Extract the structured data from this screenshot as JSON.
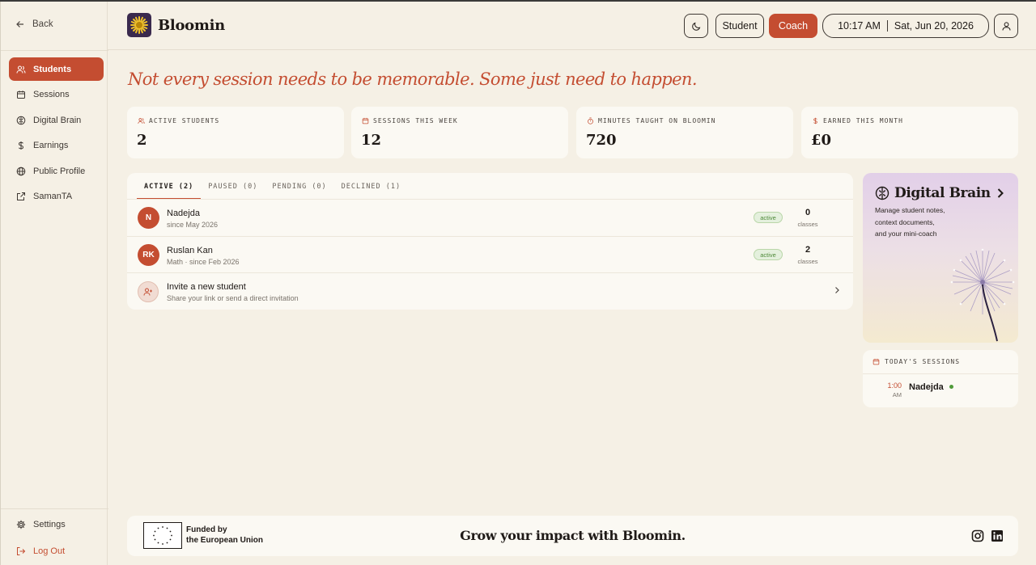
{
  "sidebar": {
    "back_label": "Back",
    "items": [
      {
        "label": "Students",
        "icon": "users-icon",
        "active": true
      },
      {
        "label": "Sessions",
        "icon": "calendar-icon"
      },
      {
        "label": "Digital Brain",
        "icon": "brain-icon"
      },
      {
        "label": "Earnings",
        "icon": "dollar-icon"
      },
      {
        "label": "Public Profile",
        "icon": "globe-icon"
      },
      {
        "label": "SamanTA",
        "icon": "external-link-icon"
      }
    ],
    "settings_label": "Settings",
    "logout_label": "Log Out"
  },
  "header": {
    "brand": "Bloomin",
    "student_label": "Student",
    "coach_label": "Coach",
    "time": "10:17 AM",
    "date": "Sat, Jun 20, 2026"
  },
  "tagline": "Not every session needs to be memorable. Some just need to happen.",
  "stats": [
    {
      "label": "ACTIVE STUDENTS",
      "value": "2",
      "icon": "users-icon"
    },
    {
      "label": "SESSIONS THIS WEEK",
      "value": "12",
      "icon": "calendar-icon"
    },
    {
      "label": "MINUTES TAUGHT ON BLOOMIN",
      "value": "720",
      "icon": "timer-icon"
    },
    {
      "label": "EARNED THIS MONTH",
      "value": "£0",
      "icon": "dollar-icon"
    }
  ],
  "tabs": [
    "ACTIVE (2)",
    "PAUSED (0)",
    "PENDING (0)",
    "DECLINED (1)"
  ],
  "students": [
    {
      "initials": "N",
      "name": "Nadejda",
      "sub": "since May 2026",
      "status": "active",
      "count": "0",
      "count_label": "classes"
    },
    {
      "initials": "RK",
      "name": "Ruslan Kan",
      "sub": "Math · since Feb 2026",
      "status": "active",
      "count": "2",
      "count_label": "classes"
    }
  ],
  "invite": {
    "title": "Invite a new student",
    "sub": "Share your link or send a direct invitation"
  },
  "digital_brain": {
    "title": "Digital Brain",
    "desc_lines": [
      "Manage student notes,",
      "context documents,",
      "and your mini-coach"
    ]
  },
  "today": {
    "label": "TODAY'S SESSIONS",
    "time": "1:00",
    "ampm": "AM",
    "name": "Nadejda"
  },
  "footer": {
    "funded_line1": "Funded by",
    "funded_line2": "the European Union",
    "slogan": "Grow your impact with Bloomin."
  },
  "colors": {
    "accent": "#c44d31",
    "background": "#f5f0e5",
    "card": "#fbf9f3",
    "success": "#4f9a3a"
  }
}
